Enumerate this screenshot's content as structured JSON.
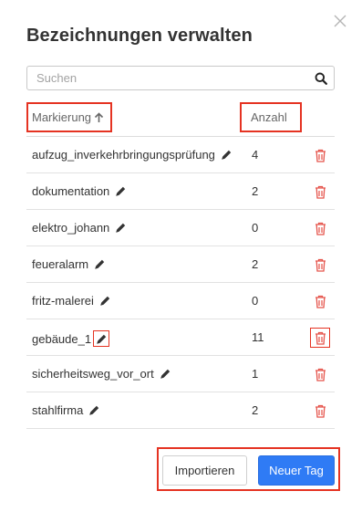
{
  "dialog": {
    "title": "Bezeichnungen verwalten",
    "close_icon": "close-icon"
  },
  "search": {
    "placeholder": "Suchen",
    "value": "",
    "icon": "search-icon"
  },
  "table": {
    "columns": {
      "marker": "Markierung",
      "count": "Anzahl"
    },
    "sort_icon": "arrow-up-icon",
    "rows": [
      {
        "name": "aufzug_inverkehrbringungsprüfung",
        "count": "4"
      },
      {
        "name": "dokumentation",
        "count": "2"
      },
      {
        "name": "elektro_johann",
        "count": "0"
      },
      {
        "name": "feueralarm",
        "count": "2"
      },
      {
        "name": "fritz-malerei",
        "count": "0"
      },
      {
        "name": "gebäude_1",
        "count": "11"
      },
      {
        "name": "sicherheitsweg_vor_ort",
        "count": "1"
      },
      {
        "name": "stahlfirma",
        "count": "2"
      }
    ]
  },
  "footer": {
    "import_label": "Importieren",
    "new_tag_label": "Neuer Tag"
  },
  "colors": {
    "primary_button": "#2f7bf5",
    "delete_icon": "#e5534b",
    "highlight": "#e53322"
  }
}
